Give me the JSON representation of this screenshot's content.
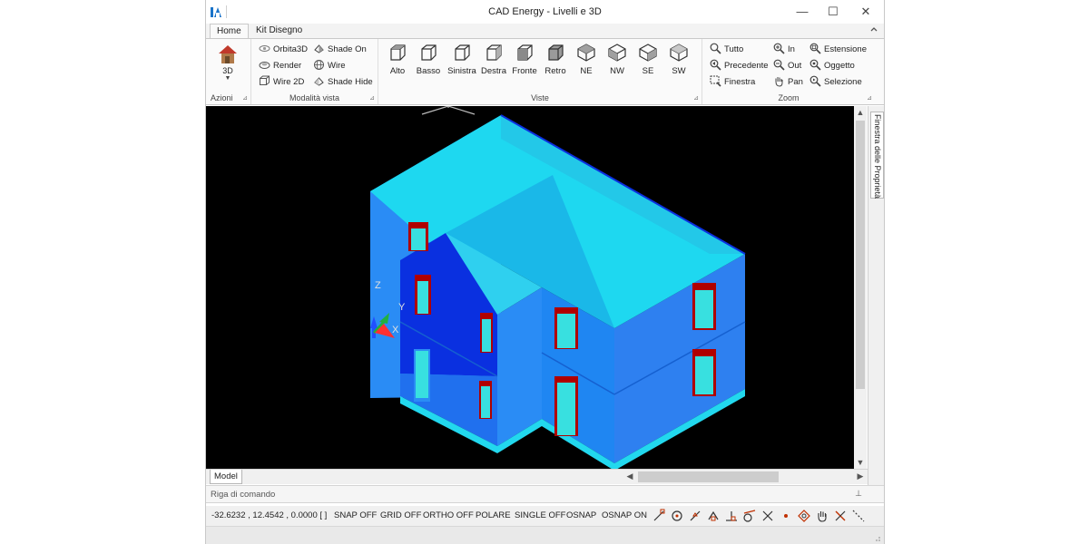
{
  "window": {
    "title": "CAD Energy - Livelli e 3D",
    "minimize": "—",
    "maximize": "☐",
    "close": "✕"
  },
  "tabs": [
    {
      "label": "Home"
    },
    {
      "label": "Kit Disegno"
    }
  ],
  "ribbon": {
    "azioni": {
      "label": "Azioni",
      "button_3d": "3D"
    },
    "modalita": {
      "label": "Modalità vista",
      "buttons": [
        "Orbita3D",
        "Shade On",
        "Render",
        "Wire",
        "Wire 2D",
        "Shade Hide"
      ]
    },
    "viste": {
      "label": "Viste",
      "buttons": [
        "Alto",
        "Basso",
        "Sinistra",
        "Destra",
        "Fronte",
        "Retro",
        "NE",
        "NW",
        "SE",
        "SW"
      ]
    },
    "zoom": {
      "label": "Zoom",
      "buttons": [
        "Tutto",
        "In",
        "Estensione",
        "Precedente",
        "Out",
        "Oggetto",
        "Finestra",
        "Pan",
        "Selezione"
      ]
    }
  },
  "viewport": {
    "axes": {
      "z": "Z",
      "y": "Y",
      "x": "X"
    },
    "colors": {
      "background": "#000000",
      "roof": "#1ed8f0",
      "wall": "#2a8cf5",
      "wall_dark": "#0a30e0",
      "window_frame": "#b00000",
      "window_glass": "#38e0e0"
    }
  },
  "side_panel": {
    "label": "Finestra delle Proprietà"
  },
  "bottom": {
    "model_tab": "Model"
  },
  "command_line": {
    "label": "Riga di comando",
    "pin": "⊥"
  },
  "status_bar": {
    "coords": "-32.6232 , 12.4542 , 0.0000 [ ]",
    "snap": "SNAP OFF",
    "grid": "GRID OFF",
    "ortho": "ORTHO OFF",
    "polare": "POLARE",
    "single": "SINGLE OFF",
    "osnap": "OSNAP",
    "osnap_on": "OSNAP ON"
  }
}
